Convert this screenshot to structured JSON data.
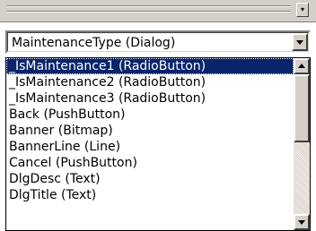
{
  "combo": {
    "value": "MaintenanceType  (Dialog)"
  },
  "list": {
    "items": [
      "_IsMaintenance1  (RadioButton)",
      "_IsMaintenance2  (RadioButton)",
      "_IsMaintenance3  (RadioButton)",
      "Back  (PushButton)",
      "Banner  (Bitmap)",
      "BannerLine  (Line)",
      "Cancel  (PushButton)",
      "DlgDesc  (Text)",
      "DlgTitle  (Text)"
    ],
    "selected_index": 0
  },
  "icons": {
    "combo_dropdown": "chevron-down-icon",
    "scroll_up": "arrow-up-icon",
    "scroll_down": "arrow-down-icon",
    "grip_button": "chevron-down-icon"
  },
  "colors": {
    "selection_bg": "#0a246a",
    "selection_text": "#ffffff",
    "face": "#d4d0c8"
  }
}
